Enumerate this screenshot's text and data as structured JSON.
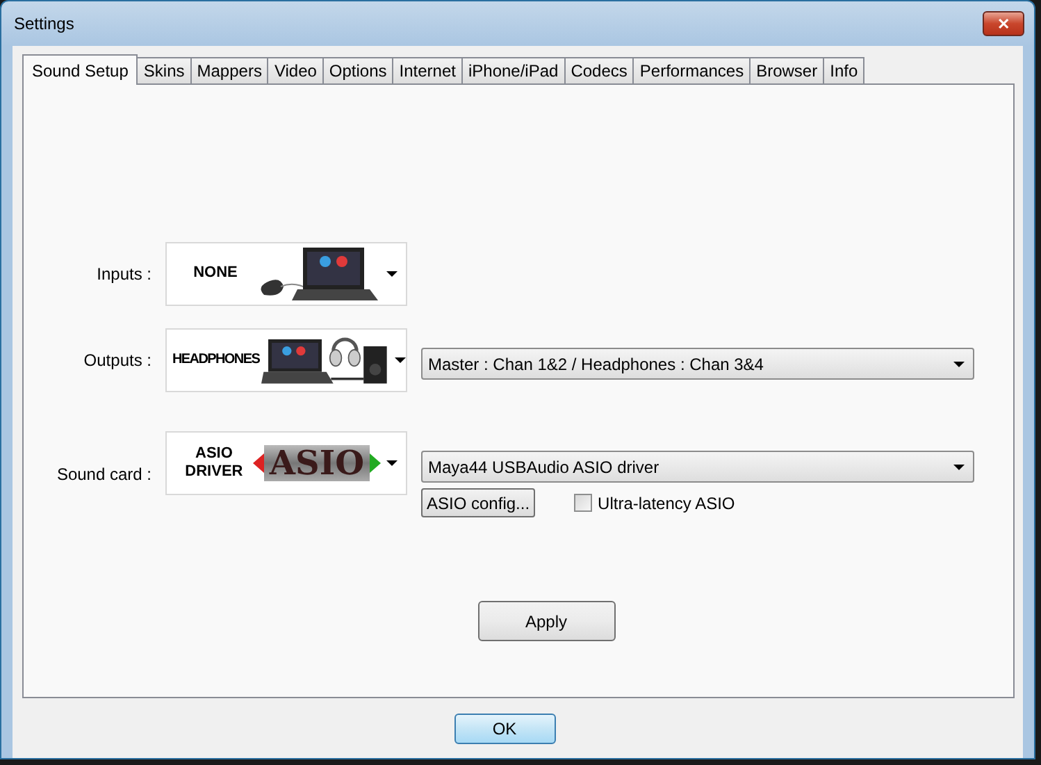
{
  "window": {
    "title": "Settings",
    "close": "✕"
  },
  "tabs": [
    {
      "label": "Sound Setup",
      "selected": true
    },
    {
      "label": "Skins",
      "selected": false
    },
    {
      "label": "Mappers",
      "selected": false
    },
    {
      "label": "Video",
      "selected": false
    },
    {
      "label": "Options",
      "selected": false
    },
    {
      "label": "Internet",
      "selected": false
    },
    {
      "label": "iPhone/iPad",
      "selected": false
    },
    {
      "label": "Codecs",
      "selected": false
    },
    {
      "label": "Performances",
      "selected": false
    },
    {
      "label": "Browser",
      "selected": false
    },
    {
      "label": "Info",
      "selected": false
    }
  ],
  "rows": [
    {
      "label": "Inputs :",
      "caption": "NONE",
      "kind": "laptop-mouse"
    },
    {
      "label": "Outputs :",
      "caption": "HEADPHONES",
      "kind": "laptop-headphones",
      "dropdown": "Master : Chan 1&2 / Headphones : Chan 3&4"
    },
    {
      "label": "Sound card :",
      "caption": "ASIO DRIVER",
      "kind": "asio-logo",
      "logo_text": "ASIO",
      "dropdown": "Maya44 USBAudio ASIO driver",
      "button": "ASIO config...",
      "checkbox": {
        "label": "Ultra-latency ASIO",
        "checked": false
      }
    }
  ],
  "apply_button": "Apply",
  "ok_button": "OK"
}
